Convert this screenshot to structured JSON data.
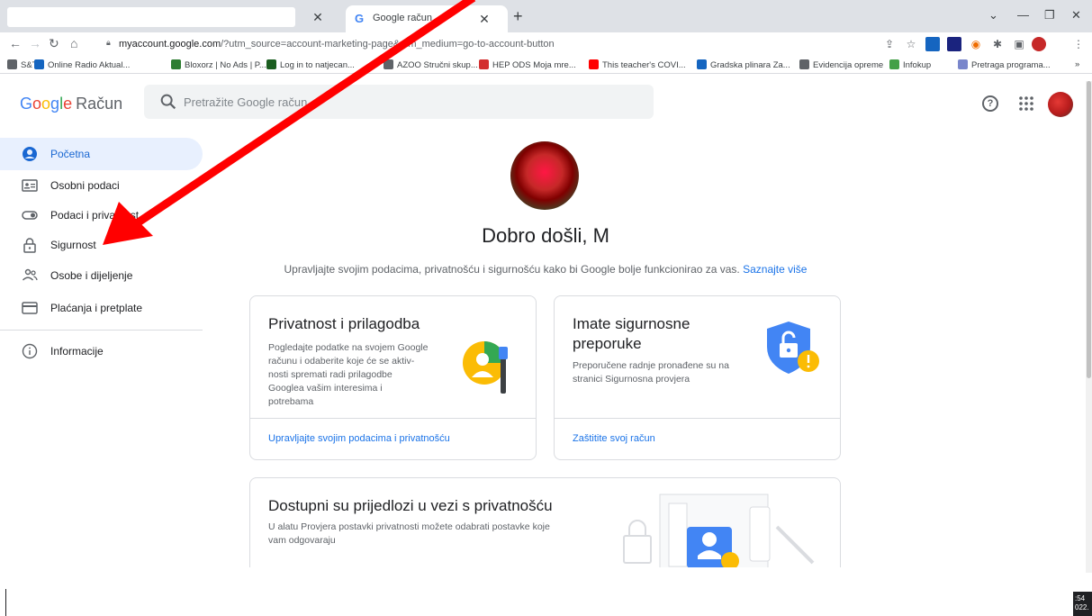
{
  "browser": {
    "tab_active_title": "Google račun",
    "address_url_domain": "myaccount.google.com",
    "address_url_rest": "/?utm_source=account-marketing-page&utm_medium=go-to-account-button",
    "bookmarks": [
      {
        "label": "S&T",
        "color": "#5f6368"
      },
      {
        "label": "Online Radio Aktual...",
        "color": "#1565c0"
      },
      {
        "label": "Bloxorz | No Ads | P...",
        "color": "#2e7d32"
      },
      {
        "label": "Log in to natjecan...",
        "color": "#1b5e20"
      },
      {
        "label": "AZOO Stručni skup...",
        "color": "#5f6368"
      },
      {
        "label": "HEP ODS Moja mre...",
        "color": "#d32f2f"
      },
      {
        "label": "This teacher's COVI...",
        "color": "#ff0000"
      },
      {
        "label": "Gradska plinara Za...",
        "color": "#1565c0"
      },
      {
        "label": "Evidencija opreme",
        "color": "#5f6368"
      },
      {
        "label": "Infokup",
        "color": "#43a047"
      },
      {
        "label": "Pretraga programa...",
        "color": "#7986cb"
      }
    ]
  },
  "header": {
    "logo_google": "Google",
    "logo_product": "Račun",
    "search_placeholder": "Pretražite Google račun"
  },
  "sidebar": {
    "items": [
      {
        "label": "Početna",
        "icon": "account-circle-icon"
      },
      {
        "label": "Osobni podaci",
        "icon": "id-card-icon"
      },
      {
        "label": "Podaci i privatnost",
        "icon": "toggle-icon"
      },
      {
        "label": "Sigurnost",
        "icon": "lock-icon"
      },
      {
        "label": "Osobe i dijeljenje",
        "icon": "people-icon"
      },
      {
        "label": "Plaćanja i pretplate",
        "icon": "credit-card-icon"
      },
      {
        "label": "Informacije",
        "icon": "info-icon"
      }
    ]
  },
  "main": {
    "welcome": "Dobro došli, M",
    "subtitle": "Upravljajte svojim podacima, privatnošću i sigurnošću kako bi Google bolje funkcionirao za vas.",
    "learn_more": "Saznajte više",
    "cards": [
      {
        "title": "Privatnost i prilagodba",
        "desc_lines": [
          "Pogledajte podatke na svojem Google",
          "računu i odaberite koje će se aktiv-",
          "nosti spremati radi prilagodbe",
          "Googlea vašim interesima i",
          "potrebama"
        ],
        "link": "Upravljajte svojim podacima i privatnošću"
      },
      {
        "title_lines": [
          "Imate sigurnosne",
          "preporuke"
        ],
        "desc_lines": [
          "Preporučene radnje pronađene su na",
          "stranici Sigurnosna provjera"
        ],
        "link": "Zaštitite svoj račun"
      },
      {
        "title": "Dostupni su prijedlozi u vezi s privatnošću",
        "desc_lines": [
          "U alatu Provjera postavki privatnosti možete odabrati postavke koje",
          "vam odgovaraju"
        ]
      }
    ]
  },
  "taskbar": {
    "clock_lines": [
      ":54",
      "022."
    ]
  },
  "colors": {
    "accent": "#1a73e8",
    "annotation_arrow": "#ff0000",
    "active_nav_bg": "#e8f0fe"
  }
}
